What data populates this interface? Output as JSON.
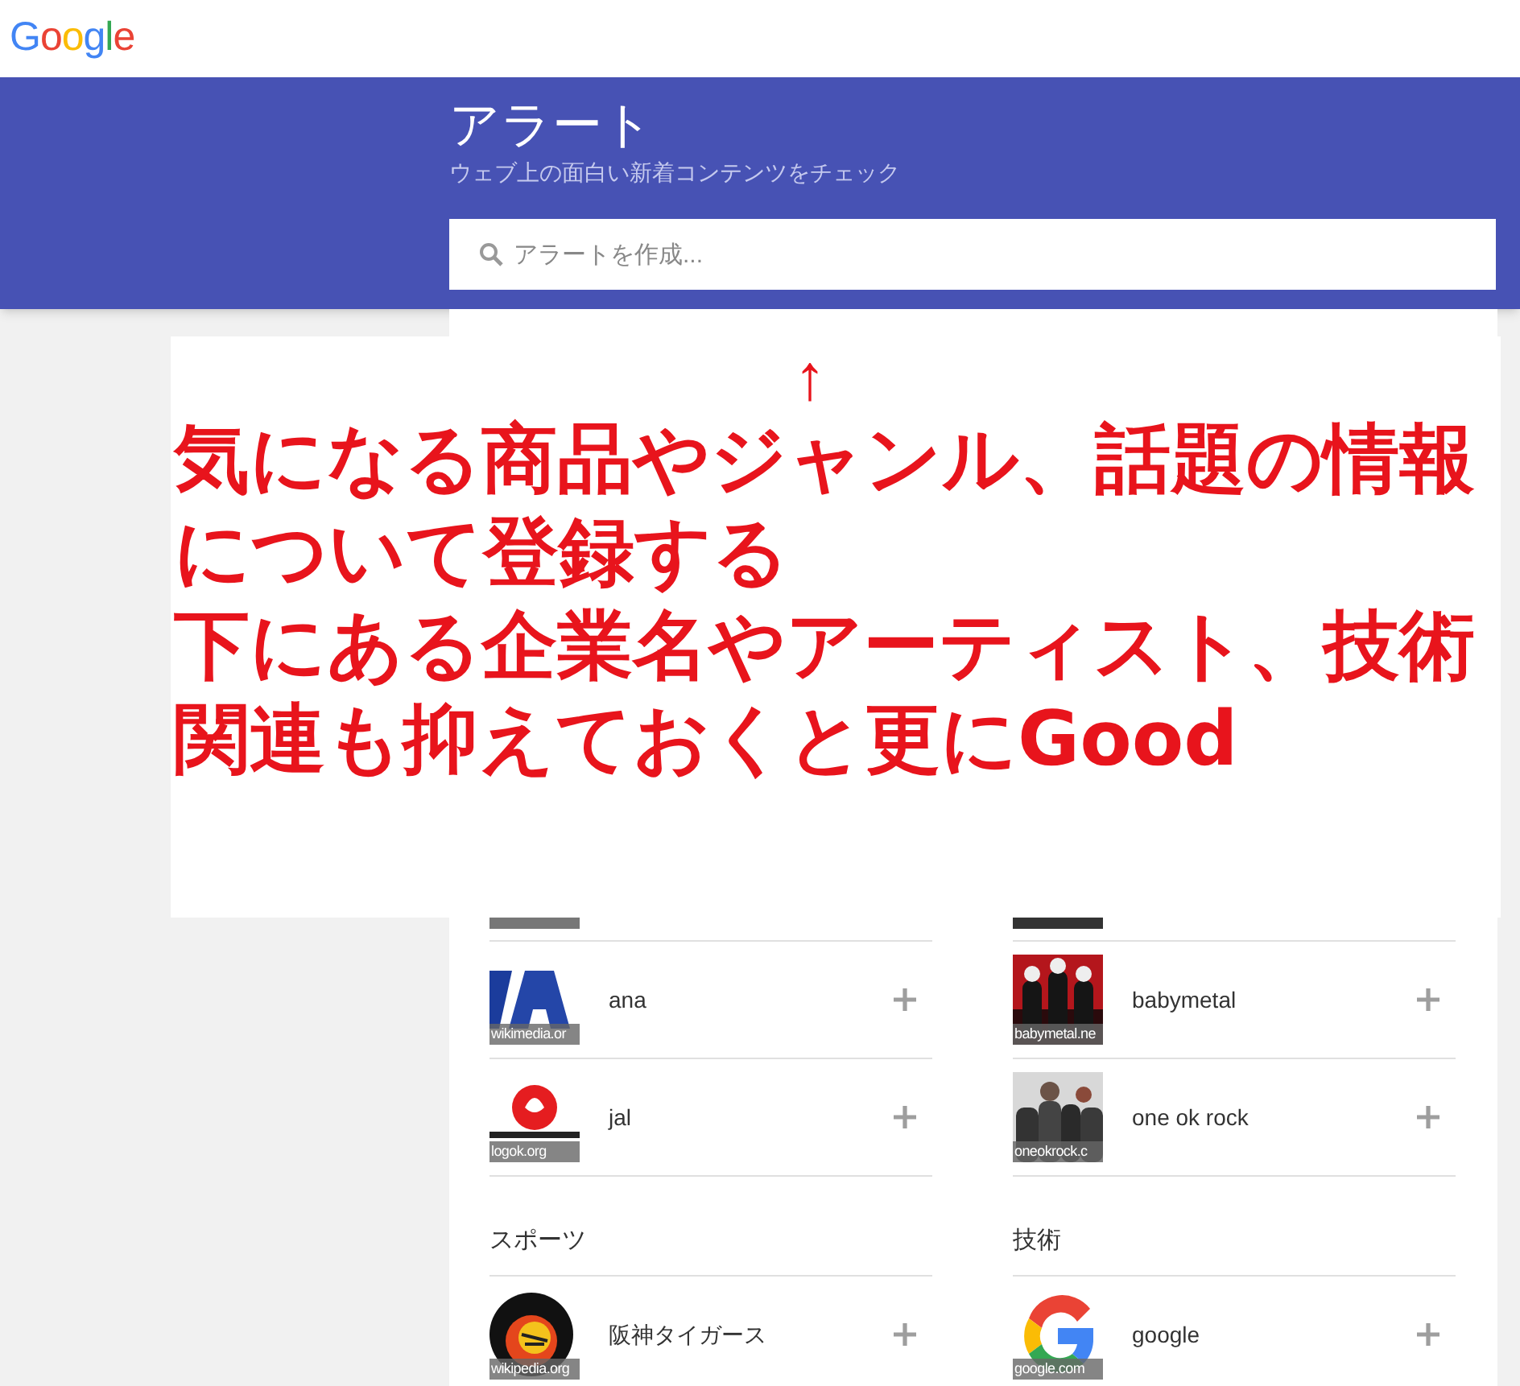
{
  "logo": "Google",
  "header": {
    "title": "アラート",
    "subtitle": "ウェブ上の面白い新着コンテンツをチェック",
    "search": {
      "placeholder": "アラートを作成..."
    }
  },
  "blocks": [
    {
      "kind": "rows",
      "columns": [
        {
          "items": [
            {
              "kind": "clipped"
            },
            {
              "kind": "row",
              "name": "ana",
              "source": "wikimedia.or"
            },
            {
              "kind": "row",
              "name": "jal",
              "source": "logok.org"
            }
          ]
        },
        {
          "items": [
            {
              "kind": "clipped"
            },
            {
              "kind": "row",
              "name": "babymetal",
              "source": "babymetal.ne"
            },
            {
              "kind": "row",
              "name": "one ok rock",
              "source": "oneokrock.c"
            }
          ]
        }
      ]
    },
    {
      "kind": "section",
      "columns": [
        {
          "heading": "スポーツ",
          "items": [
            {
              "kind": "row",
              "name": "阪神タイガース",
              "source": "wikipedia.org"
            }
          ]
        },
        {
          "heading": "技術",
          "items": [
            {
              "kind": "row",
              "name": "google",
              "source": "google.com"
            }
          ]
        }
      ]
    }
  ],
  "annotation": {
    "arrow": "↑",
    "paragraphs": [
      "気になる商品やジャンル、話題の情報について登録する",
      "下にある企業名やアーティスト、技術関連も抑えておくと更にGood"
    ]
  }
}
